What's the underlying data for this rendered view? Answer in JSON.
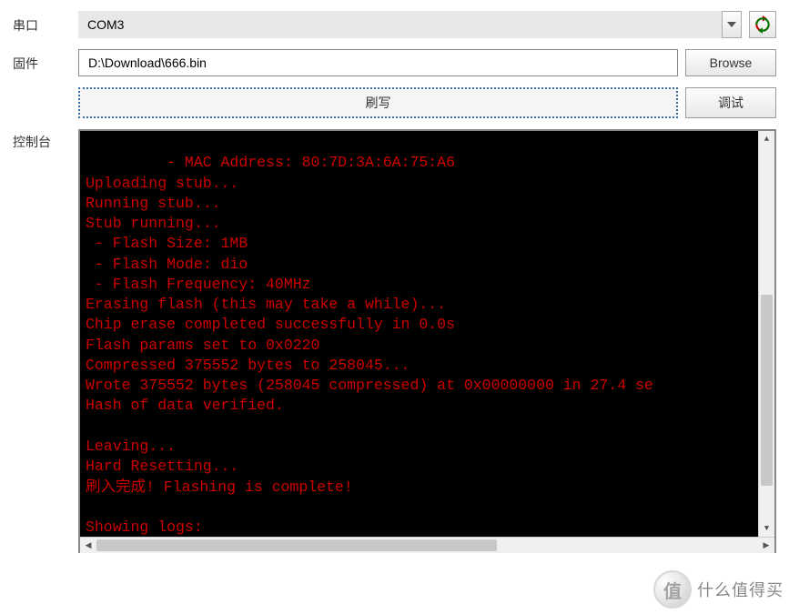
{
  "labels": {
    "port": "串口",
    "firmware": "固件",
    "console": "控制台"
  },
  "port": {
    "selected": "COM3"
  },
  "firmware": {
    "path": "D:\\Download\\666.bin"
  },
  "buttons": {
    "browse": "Browse",
    "flash": "刷写",
    "debug": "调试"
  },
  "console_lines": [
    " - MAC Address: 80:7D:3A:6A:75:A6",
    "Uploading stub...",
    "Running stub...",
    "Stub running...",
    " - Flash Size: 1MB",
    " - Flash Mode: dio",
    " - Flash Frequency: 40MHz",
    "Erasing flash (this may take a while)...",
    "Chip erase completed successfully in 0.0s",
    "Flash params set to 0x0220",
    "Compressed 375552 bytes to 258045...",
    "Wrote 375552 bytes (258045 compressed) at 0x00000000 in 27.4 se",
    "Hash of data verified.",
    "",
    "Leaving...",
    "Hard Resetting...",
    "刷入完成! Flashing is complete!",
    "",
    "Showing logs:"
  ],
  "watermark": {
    "badge": "值",
    "text": "什么值得买"
  },
  "icons": {
    "dropdown": "▾",
    "up": "▲",
    "down": "▼",
    "left": "◀",
    "right": "▶"
  }
}
